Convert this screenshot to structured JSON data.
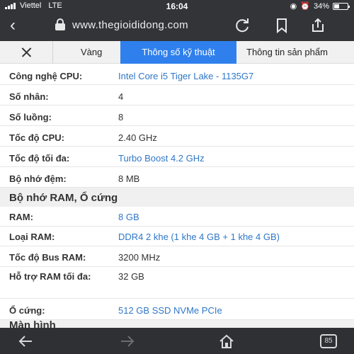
{
  "status_bar": {
    "carrier": "Viettel",
    "network": "LTE",
    "time": "16:04",
    "battery": "34%"
  },
  "browser": {
    "url": "www.thegioididong.com"
  },
  "tabs": {
    "items": [
      "Vàng",
      "Thông số kỹ thuật",
      "Thông tin sản phẩm"
    ],
    "active_index": 1
  },
  "specs": {
    "cpu": [
      {
        "label": "Công nghệ CPU:",
        "value": "Intel Core i5 Tiger Lake - 1135G7",
        "link": true
      },
      {
        "label": "Số nhân:",
        "value": "4",
        "link": false
      },
      {
        "label": "Số luồng:",
        "value": "8",
        "link": false
      },
      {
        "label": "Tốc độ CPU:",
        "value": "2.40 GHz",
        "link": false
      },
      {
        "label": "Tốc độ tối đa:",
        "value": "Turbo Boost 4.2 GHz",
        "link": true
      },
      {
        "label": "Bộ nhớ đệm:",
        "value": "8 MB",
        "link": false
      }
    ],
    "memory_section_title": "Bộ nhớ RAM, Ổ cứng",
    "memory": [
      {
        "label": "RAM:",
        "value": "8 GB",
        "link": true
      },
      {
        "label": "Loại RAM:",
        "value": "DDR4 2 khe (1 khe 4 GB + 1 khe 4 GB)",
        "link": true
      },
      {
        "label": "Tốc độ Bus RAM:",
        "value": "3200 MHz",
        "link": false
      },
      {
        "label": "Hỗ trợ RAM tối đa:",
        "value": "32 GB",
        "link": false
      },
      {
        "label": "Ổ cứng:",
        "value": "512 GB SSD NVMe PCIe",
        "link": true
      }
    ],
    "display_section_title": "Màn hình"
  },
  "bottom_bar": {
    "tab_count": "85"
  },
  "colors": {
    "chrome_dark": "#323438",
    "active_tab": "#2f80ed",
    "link": "#2f77c8"
  }
}
